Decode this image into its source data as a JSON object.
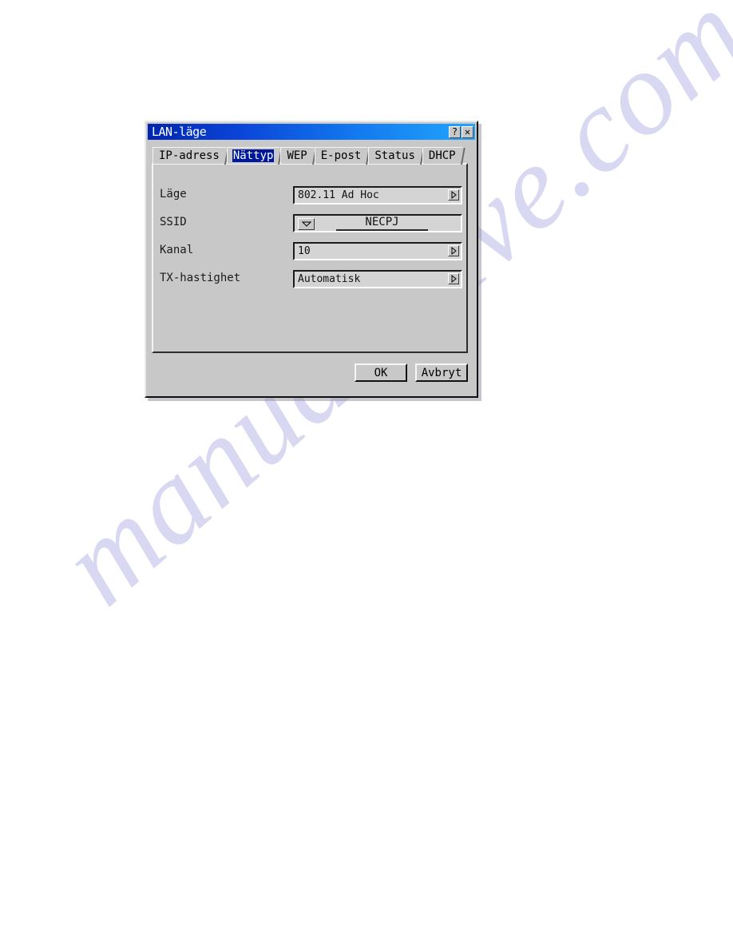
{
  "page": {
    "background_color": "#ffffff",
    "watermark": {
      "text": "manualshive.com",
      "color": "#d8d8f2"
    }
  },
  "dialog": {
    "titlebar": {
      "title": "LAN-läge",
      "gradient_from": "#0025b0",
      "gradient_to": "#21a6ff",
      "buttons": [
        {
          "name": "help",
          "glyph": "?"
        },
        {
          "name": "close",
          "glyph": "✕"
        }
      ]
    },
    "tabs": [
      {
        "label": "IP-adress",
        "selected": false
      },
      {
        "label": "Nättyp",
        "selected": true
      },
      {
        "label": "WEP",
        "selected": false
      },
      {
        "label": "E-post",
        "selected": false
      },
      {
        "label": "Status",
        "selected": false
      },
      {
        "label": "DHCP",
        "selected": false
      }
    ],
    "selected_tab_highlight": "#00199c",
    "face_color": "#c8c8c8",
    "form": {
      "rows": [
        {
          "label": "Läge",
          "control": "combo-spin",
          "value": "802.11 Ad Hoc",
          "icon": "spin-right-arrow-icon"
        },
        {
          "label": "SSID",
          "control": "dropdown-text",
          "value": "NECPJ",
          "icon": "chevron-down-icon"
        },
        {
          "label": "Kanal",
          "control": "combo-spin",
          "value": "10",
          "icon": "spin-right-arrow-icon"
        },
        {
          "label": "TX-hastighet",
          "control": "combo-spin",
          "value": "Automatisk",
          "icon": "spin-right-arrow-icon"
        }
      ]
    },
    "footer": {
      "ok_label": "OK",
      "cancel_label": "Avbryt"
    }
  }
}
